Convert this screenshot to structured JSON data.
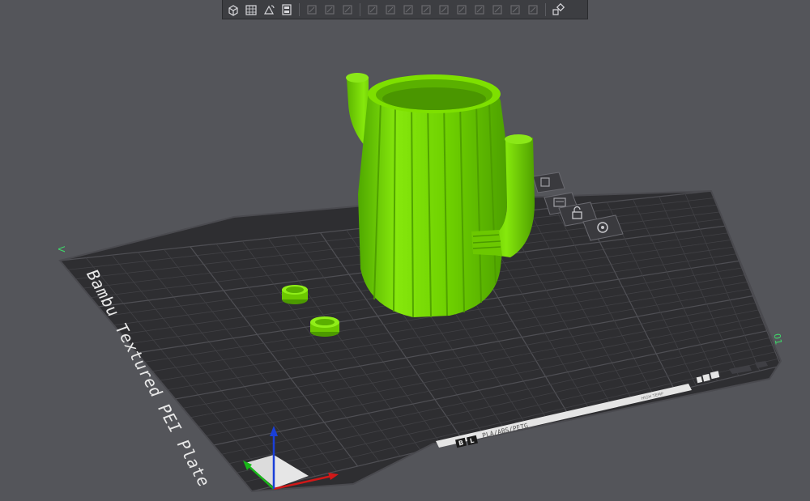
{
  "plate": {
    "name": "Bambu Textured PEI Plate",
    "strip_text": "PLA/ABS/PETG",
    "strip_logo_b": "B",
    "strip_logo_l": "L",
    "corner_left_label": "V",
    "corner_right_label": "01",
    "right_strip_text": "HIGH TEMP"
  },
  "toolbar": {
    "buttons": [
      {
        "name": "add-object-button",
        "icon": "cube-plus-icon",
        "enabled": true
      },
      {
        "name": "add-plate-button",
        "icon": "grid-plus-icon",
        "enabled": true
      },
      {
        "name": "auto-orient-button",
        "icon": "orient-icon",
        "enabled": true
      },
      {
        "name": "arrange-button",
        "icon": "arrange-icon",
        "enabled": true
      },
      {
        "name": "split-objects-button",
        "icon": "split-icon",
        "enabled": false
      },
      {
        "name": "split-parts-button",
        "icon": "split-parts-icon",
        "enabled": false
      },
      {
        "name": "layers-button",
        "icon": "layers-icon",
        "enabled": false
      },
      {
        "name": "move-button",
        "icon": "move-icon",
        "enabled": false
      },
      {
        "name": "rotate-button",
        "icon": "rotate-icon",
        "enabled": false
      },
      {
        "name": "scale-button",
        "icon": "scale-icon",
        "enabled": false
      },
      {
        "name": "lay-on-face-button",
        "icon": "face-icon",
        "enabled": false
      },
      {
        "name": "cut-button",
        "icon": "cut-icon",
        "enabled": false
      },
      {
        "name": "mesh-boolean-button",
        "icon": "boolean-icon",
        "enabled": false
      },
      {
        "name": "supports-paint-button",
        "icon": "support-paint-icon",
        "enabled": false
      },
      {
        "name": "seam-paint-button",
        "icon": "seam-icon",
        "enabled": false
      },
      {
        "name": "text-shape-button",
        "icon": "text-icon",
        "enabled": false
      },
      {
        "name": "measure-button",
        "icon": "measure-icon",
        "enabled": false
      },
      {
        "name": "assembly-view-button",
        "icon": "assembly-icon",
        "enabled": true
      }
    ]
  },
  "colors": {
    "background": "#54555a",
    "plate": "#2e2e31",
    "grid": "#47474b",
    "model": "#7fe000",
    "axis_x": "#d01818",
    "axis_y": "#18b818",
    "axis_z": "#1a3fd8",
    "label_green": "#3fd86a"
  }
}
